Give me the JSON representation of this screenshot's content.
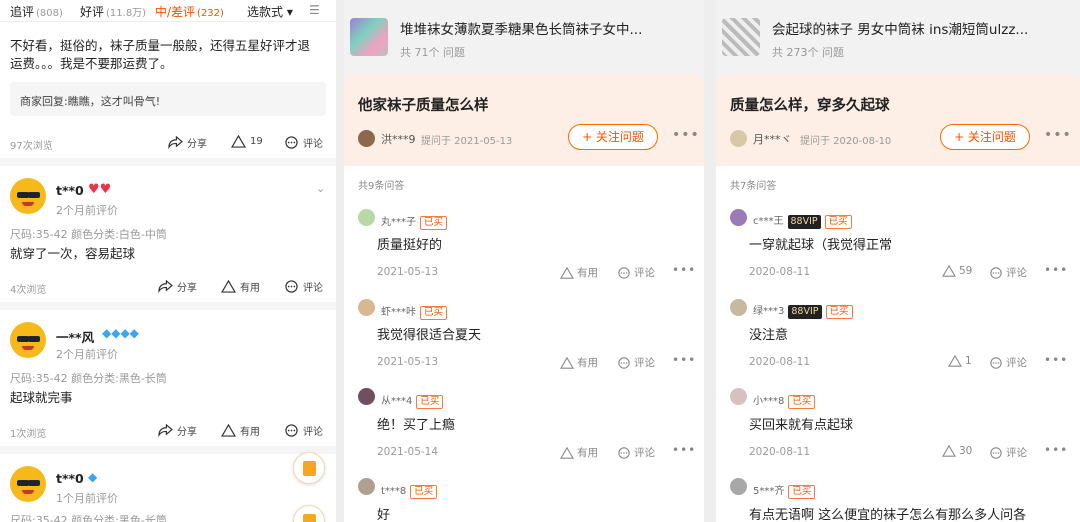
{
  "left_panel": {
    "tabs": [
      {
        "label": "追评",
        "count": "(808)"
      },
      {
        "label": "好评",
        "count": "(11.8万)"
      },
      {
        "label": "中/差评",
        "count": "(232)"
      },
      {
        "label": "选款式"
      }
    ],
    "review1": {
      "text_line1": "不好看，挺俗的，袜子质量一般般，还得五星好评才退",
      "text_line2": "运费。。。我是不要那运费了。",
      "reply": "商家回复:瞧瞧，这才叫骨气!",
      "views": "97次浏览",
      "share": "分享",
      "likes": "19",
      "comment": "评论"
    },
    "review2": {
      "user": "t**0",
      "time": "2个月前评价",
      "sku": "尺码:35-42 颜色分类:白色-中筒",
      "text": "就穿了一次，容易起球",
      "views": "4次浏览",
      "share": "分享",
      "likes": "有用",
      "comment": "评论"
    },
    "review3": {
      "user": "一**风",
      "time": "2个月前评价",
      "sku": "尺码:35-42 颜色分类:黑色-长筒",
      "text": "起球就完事",
      "views": "1次浏览",
      "share": "分享",
      "likes": "有用",
      "comment": "评论"
    },
    "review4": {
      "user": "t**0",
      "time": "1个月前评价",
      "sku": "尺码:35-42 颜色分类:黑色-长筒"
    }
  },
  "mid_panel": {
    "product_title": "堆堆袜女薄款夏季糖果色长筒袜子女中...",
    "product_count": "共 71个 问题",
    "question": "他家袜子质量怎么样",
    "asker": "洪***9",
    "asked": "提问于 2021-05-13",
    "follow": "+ 关注问题",
    "total": "共9条问答",
    "answers": [
      {
        "user": "丸***子",
        "badge": "已买",
        "text": "质量挺好的",
        "date": "2021-05-13",
        "useful": "有用",
        "comment": "评论"
      },
      {
        "user": "虾***咔",
        "badge": "已买",
        "text": "我觉得很适合夏天",
        "date": "2021-05-13",
        "useful": "有用",
        "comment": "评论"
      },
      {
        "user": "从***4",
        "badge": "已买",
        "text": "绝！买了上瘾",
        "date": "2021-05-14",
        "useful": "有用",
        "comment": "评论"
      },
      {
        "user": "t***8",
        "badge": "已买",
        "text": "好"
      }
    ]
  },
  "right_panel": {
    "product_title": "会起球的袜子 男女中筒袜 ins潮短筒ulzz...",
    "product_count": "共 273个 问题",
    "question": "质量怎么样，穿多久起球",
    "asker": "月***ヾ",
    "asked": "提问于 2020-08-10",
    "follow": "+ 关注问题",
    "total": "共7条问答",
    "answers": [
      {
        "user": "c***王",
        "vip": "88VIP",
        "badge": "已买",
        "text": "一穿就起球（我觉得正常",
        "date": "2020-08-11",
        "useful": "59",
        "comment": "评论"
      },
      {
        "user": "绿***3",
        "vip": "88VIP",
        "badge": "已买",
        "text": "没注意",
        "date": "2020-08-11",
        "useful": "1",
        "comment": "评论"
      },
      {
        "user": "小***8",
        "badge": "已买",
        "text": "买回来就有点起球",
        "date": "2020-08-11",
        "useful": "30",
        "comment": "评论"
      },
      {
        "user": "5***齐",
        "badge": "已买",
        "text": "有点无语啊 这么便宜的袜子怎么有那么多人问各"
      }
    ]
  },
  "colors": {
    "accent": "#ff5000",
    "question_bg": "#fdeee6"
  }
}
